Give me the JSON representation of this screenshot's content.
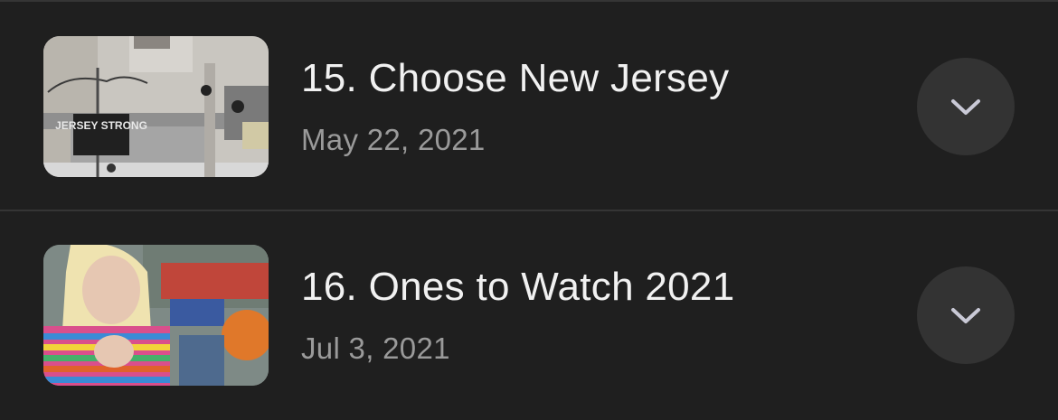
{
  "episodes": [
    {
      "title": "15. Choose New Jersey",
      "date": "May 22, 2021",
      "thumbnail_text": "JERSEY STRONG",
      "expand_icon": "chevron-down-icon"
    },
    {
      "title": "16. Ones to Watch 2021",
      "date": "Jul 3, 2021",
      "expand_icon": "chevron-down-icon"
    }
  ],
  "colors": {
    "background": "#1f1f1f",
    "divider": "#353535",
    "title": "#f1f1f1",
    "date": "#9a9a9a",
    "button_bg": "#333333",
    "chevron": "#c9c9d6"
  }
}
